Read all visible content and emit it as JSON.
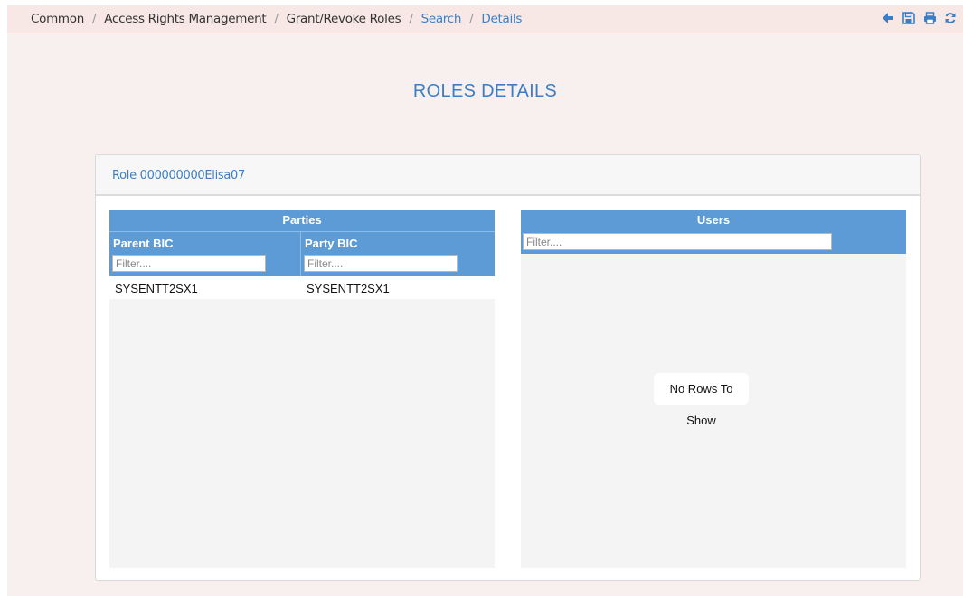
{
  "breadcrumb": {
    "common": "Common",
    "access_rights": "Access Rights Management",
    "grant_revoke": "Grant/Revoke Roles",
    "search": "Search",
    "details": "Details",
    "separator": "/"
  },
  "toolbar": {
    "icons": [
      "back-arrow-icon",
      "save-icon",
      "print-icon",
      "refresh-icon"
    ],
    "color": "#3c7ec6"
  },
  "page": {
    "title": "ROLES DETAILS"
  },
  "role_panel": {
    "header": "Role 000000000Elisa07"
  },
  "parties_grid": {
    "title": "Parties",
    "columns": [
      {
        "label": "Parent BIC",
        "filter_placeholder": "Filter...."
      },
      {
        "label": "Party BIC",
        "filter_placeholder": "Filter...."
      }
    ],
    "rows": [
      {
        "parent_bic": "SYSENTT2SX1",
        "party_bic": "SYSENTT2SX1"
      }
    ]
  },
  "users_grid": {
    "title": "Users",
    "filter_placeholder": "Filter....",
    "empty_message": "No Rows To Show"
  },
  "colors": {
    "accent": "#3c7ec6",
    "grid_header": "#5d9bd6",
    "page_bg": "#f8f0ee"
  }
}
